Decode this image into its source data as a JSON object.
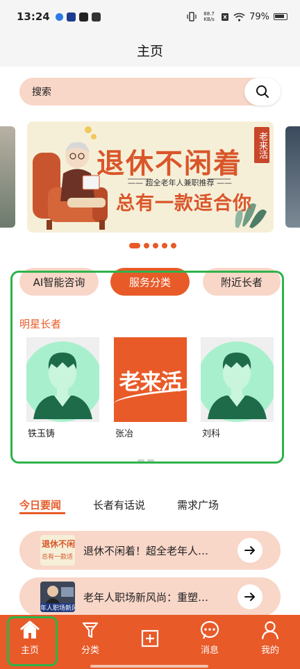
{
  "status_bar": {
    "time": "13:24",
    "net_speed_value": "88.7",
    "net_speed_unit": "KB/s",
    "battery": "79%"
  },
  "header": {
    "title": "主页"
  },
  "search": {
    "placeholder": "搜索"
  },
  "banner": {
    "title": "退休不闲着",
    "subtitle": "—— 超全老年人兼职推荐 ——",
    "slogan": "总有一款适合你",
    "stamp": "老来活",
    "active_index": 0,
    "count": 5
  },
  "categories": [
    {
      "label": "AI智能咨询",
      "active": false
    },
    {
      "label": "服务分类",
      "active": true
    },
    {
      "label": "附近长者",
      "active": false
    }
  ],
  "star_elders": {
    "title": "明星长者",
    "items": [
      {
        "name": "铁玉铸",
        "avatar": "default-avatar"
      },
      {
        "name": "张冶",
        "avatar": "brand-logo",
        "logo_text": "老来活"
      },
      {
        "name": "刘科",
        "avatar": "default-avatar"
      }
    ]
  },
  "news_tabs": [
    {
      "label": "今日要闻",
      "active": true
    },
    {
      "label": "长者有话说",
      "active": false
    },
    {
      "label": "需求广场",
      "active": false
    }
  ],
  "news": [
    {
      "title": "退休不闲着！超全老年人…",
      "thumb_text_1": "退休不闲",
      "thumb_text_2": "总有一款适"
    },
    {
      "title": "老年人职场新风尚：重塑…",
      "thumb_text_1": "年人职场新风"
    }
  ],
  "bottom_nav": [
    {
      "label": "主页",
      "icon": "home-icon",
      "active": true
    },
    {
      "label": "分类",
      "icon": "filter-icon",
      "active": false
    },
    {
      "label": "",
      "icon": "add-square-icon",
      "active": false
    },
    {
      "label": "消息",
      "icon": "chat-icon",
      "active": false
    },
    {
      "label": "我的",
      "icon": "user-icon",
      "active": false
    }
  ],
  "colors": {
    "accent": "#e85a28",
    "accent_light": "#f8d6c8",
    "highlight": "#2db34a"
  }
}
